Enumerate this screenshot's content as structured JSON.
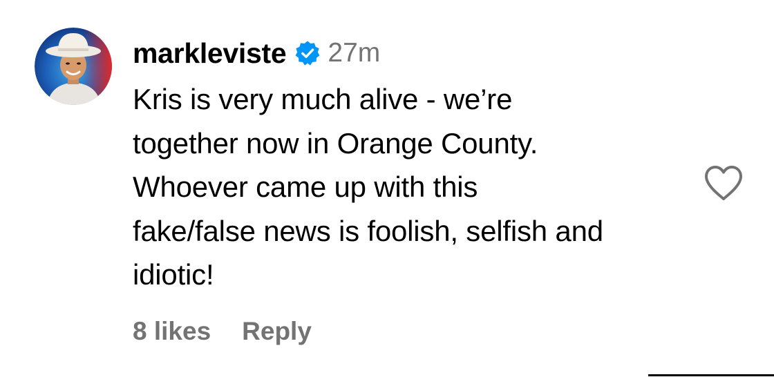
{
  "comment": {
    "username": "markleviste",
    "verified_icon": "verified-badge-icon",
    "time_ago": "27m",
    "text": "Kris is very much alive - we’re\ntogether now in Orange County.\nWhoever came up with this\nfake/false news is foolish, selfish and\nidiotic!",
    "likes_label": "8 likes",
    "reply_label": "Reply",
    "like_icon": "heart-outline-icon",
    "avatar_icon": "profile-avatar"
  },
  "colors": {
    "verified": "#0095f6",
    "secondary_text": "#737373",
    "primary_text": "#000000",
    "heart_outline": "#737373"
  }
}
